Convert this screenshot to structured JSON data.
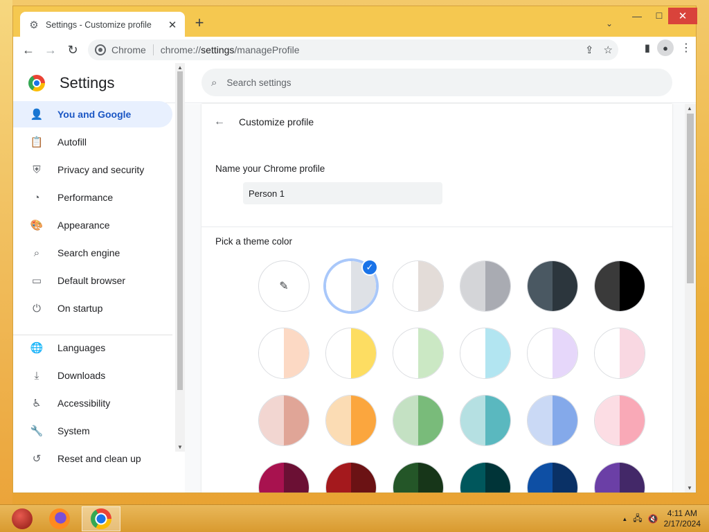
{
  "window": {
    "tab_title": "Settings - Customize profile",
    "tab_close": "✕",
    "new_tab": "+",
    "tab_search": "⌄",
    "minimize": "—",
    "maximize": "☐",
    "close": "✕"
  },
  "toolbar": {
    "back": "←",
    "forward": "→",
    "reload": "↻",
    "omnibox_chip": "Chrome",
    "url_prefix": "chrome://",
    "url_host": "settings",
    "url_path": "/manageProfile",
    "share": "⇪",
    "bookmark": "☆",
    "side_panel": "▮",
    "profile": "●",
    "menu": "⋮"
  },
  "header": {
    "title": "Settings",
    "search_placeholder": "Search settings",
    "search_icon": "⌕"
  },
  "sidebar": {
    "items": [
      {
        "label": "You and Google",
        "icon": "👤"
      },
      {
        "label": "Autofill",
        "icon": "📋"
      },
      {
        "label": "Privacy and security",
        "icon": "⛨"
      },
      {
        "label": "Performance",
        "icon": "◔"
      },
      {
        "label": "Appearance",
        "icon": "🎨"
      },
      {
        "label": "Search engine",
        "icon": "⌕"
      },
      {
        "label": "Default browser",
        "icon": "▭"
      },
      {
        "label": "On startup",
        "icon": "⏻"
      },
      {
        "label": "Languages",
        "icon": "🌐"
      },
      {
        "label": "Downloads",
        "icon": "⤓"
      },
      {
        "label": "Accessibility",
        "icon": "♿"
      },
      {
        "label": "System",
        "icon": "🔧"
      },
      {
        "label": "Reset and clean up",
        "icon": "↺"
      }
    ]
  },
  "profile": {
    "back_icon": "←",
    "title": "Customize profile",
    "name_label": "Name your Chrome profile",
    "name_value": "Person 1",
    "theme_label": "Pick a theme color",
    "picker_icon": "✎",
    "check_icon": "✓",
    "selected_index": 1,
    "swatches": [
      {
        "left": "#ffffff",
        "right": "#f1f3f4"
      },
      {
        "left": "#ffffff",
        "right": "#dee1e6"
      },
      {
        "left": "#ffffff",
        "right": "#e3dcd8"
      },
      {
        "left": "#d4d5d8",
        "right": "#a9abb2"
      },
      {
        "left": "#4a5862",
        "right": "#2c363d"
      },
      {
        "left": "#3a3a3a",
        "right": "#000000"
      },
      {
        "left": "#ffffff",
        "right": "#fcd9c4"
      },
      {
        "left": "#ffffff",
        "right": "#fddd62"
      },
      {
        "left": "#ffffff",
        "right": "#cbe8c4"
      },
      {
        "left": "#ffffff",
        "right": "#b2e5f1"
      },
      {
        "left": "#ffffff",
        "right": "#e6d7fa"
      },
      {
        "left": "#ffffff",
        "right": "#f9d8e2"
      },
      {
        "left": "#f2d6d1",
        "right": "#e0a597"
      },
      {
        "left": "#fbdcb4",
        "right": "#fba63e"
      },
      {
        "left": "#c4e1c3",
        "right": "#79bb7a"
      },
      {
        "left": "#b5e0e2",
        "right": "#5ab8bf"
      },
      {
        "left": "#cad9f5",
        "right": "#84a9ea"
      },
      {
        "left": "#fcdde4",
        "right": "#f9a9b7"
      },
      {
        "left": "#a8124f",
        "right": "#6b1034"
      },
      {
        "left": "#a4191d",
        "right": "#6b1214"
      },
      {
        "left": "#245628",
        "right": "#173619"
      },
      {
        "left": "#00575c",
        "right": "#003438"
      },
      {
        "left": "#0e4fa4",
        "right": "#0a3166"
      },
      {
        "left": "#6b3fa6",
        "right": "#432868"
      }
    ]
  },
  "taskbar": {
    "time": "4:11 AM",
    "date": "2/17/2024",
    "tray_arrow": "▲",
    "network": "🖧",
    "volume": "🔇"
  }
}
